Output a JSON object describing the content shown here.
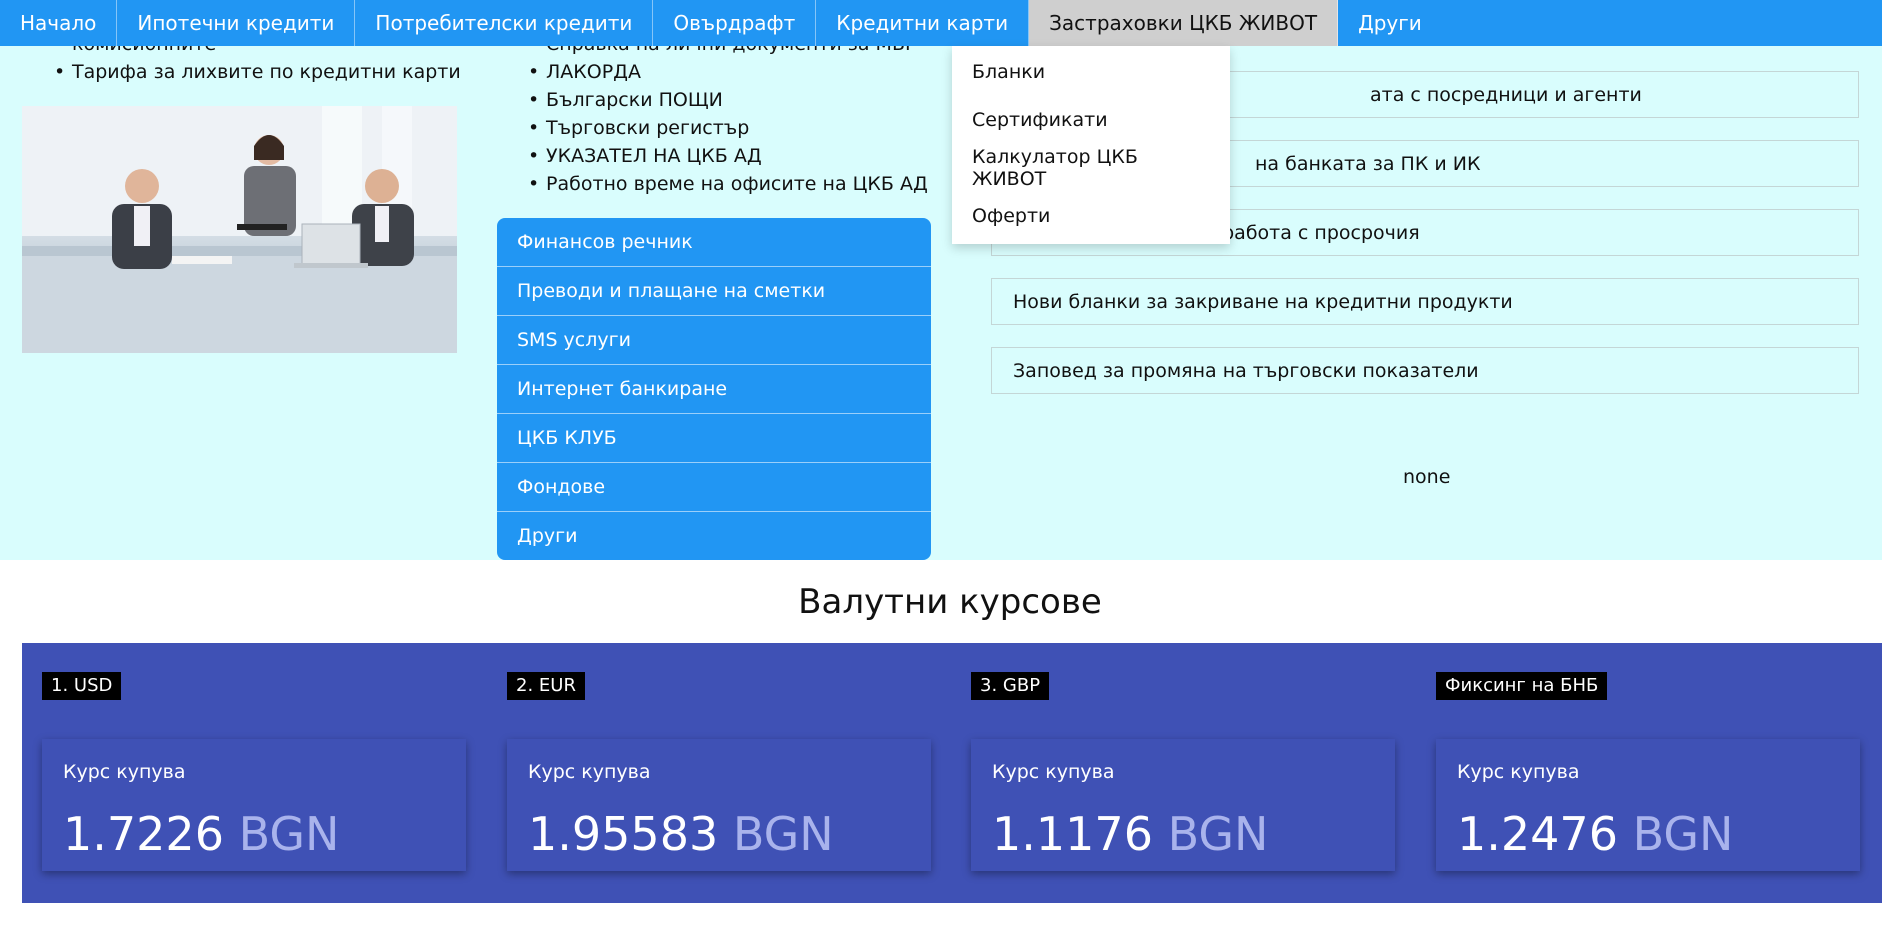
{
  "nav": {
    "items": [
      "Начало",
      "Ипотечни кредити",
      "Потребителски кредити",
      "Овърдрафт",
      "Кредитни карти",
      "Застраховки ЦКБ ЖИВОТ",
      "Други"
    ]
  },
  "dropdown": {
    "items": [
      "Бланки",
      "Сертификати",
      "Калкулатор ЦКБ ЖИВОТ",
      "Оферти"
    ]
  },
  "left_list": [
    "комисионните",
    "Тарифа за лихвите по кредитни карти"
  ],
  "mid_list": [
    "Справка на лични документи за МВР",
    "ЛАКОРДА",
    "Български ПОЩИ",
    "Търговски регистър",
    "УКАЗАТЕЛ НА ЦКБ АД",
    "Работно време на офисите на ЦКБ АД"
  ],
  "side_menu": [
    "Финансов речник",
    "Преводи и плащане на сметки",
    "SMS услуги",
    "Интернет банкиране",
    "ЦКБ КЛУБ",
    "Фондове",
    "Други"
  ],
  "news": [
    "ата с посредници и агенти",
    "на банката за ПК и ИК",
    "Нова декларация за работа с просрочия",
    "Нови бланки за закриване на кредитни продукти",
    "Заповед за промяна на търговски показатели"
  ],
  "none_text": "none",
  "fx": {
    "title": "Валутни курсове",
    "cards": [
      {
        "label": "1. USD",
        "rate_label": "Курс купува",
        "value": "1.7226",
        "unit": "BGN"
      },
      {
        "label": "2. EUR",
        "rate_label": "Курс купува",
        "value": "1.95583",
        "unit": "BGN"
      },
      {
        "label": "3. GBP",
        "rate_label": "Курс купува",
        "value": "1.1176",
        "unit": "BGN"
      },
      {
        "label": "Фиксинг на БНБ",
        "rate_label": "Курс купува",
        "value": "1.2476",
        "unit": "BGN"
      }
    ]
  },
  "colors": {
    "primary": "#2196f3",
    "band": "#d9fdfd",
    "fx_panel": "#3f51b5",
    "nav_active": "#cfcfcf"
  }
}
